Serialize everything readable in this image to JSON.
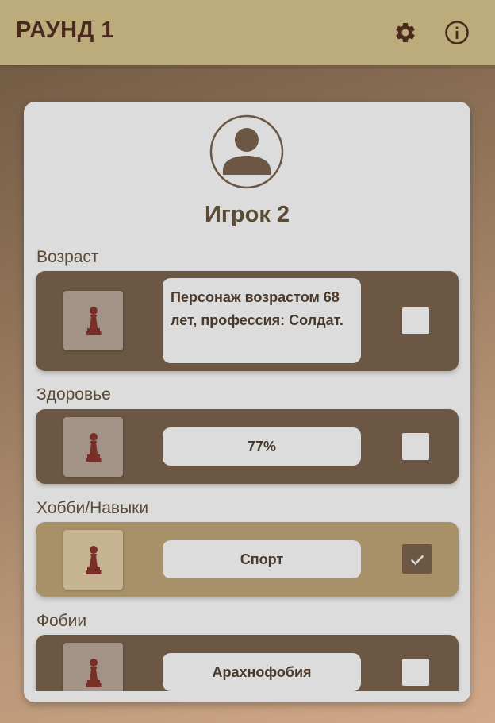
{
  "appbar": {
    "title": "РАУНД 1",
    "icons": [
      "gear-icon",
      "info-icon"
    ],
    "color": "#bcac7b"
  },
  "player": {
    "name": "Игрок 2",
    "avatar_icon": "account-circle-icon"
  },
  "traits": [
    {
      "label": "Возраст",
      "value": "Персонаж возрастом 68 лет, профессия: Солдат.",
      "checked": false
    },
    {
      "label": "Здоровье",
      "value": "77%",
      "checked": false
    },
    {
      "label": "Хобби/Навыки",
      "value": "Спорт",
      "checked": true
    },
    {
      "label": "Фобии",
      "value": "Арахнофобия",
      "checked": false
    }
  ],
  "colors": {
    "row_default": "#6b5744",
    "row_checked": "#a89068",
    "card": "#dcdcdc",
    "accent_text": "#4a2a1c"
  }
}
